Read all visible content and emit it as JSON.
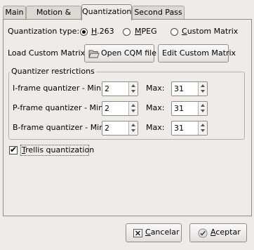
{
  "tabs": [
    {
      "label": "Main"
    },
    {
      "label": "Motion & Misc"
    },
    {
      "label": "Quantization"
    },
    {
      "label": "Second Pass"
    }
  ],
  "quant_type": {
    "label": "Quantization type:",
    "options": [
      {
        "label": "H.263",
        "selected": true
      },
      {
        "label": "MPEG",
        "selected": false
      },
      {
        "label": "Custom Matrix",
        "selected": false
      }
    ]
  },
  "custom_matrix": {
    "label": "Load Custom Matrix:",
    "open_label": "Open CQM file",
    "edit_label": "Edit Custom Matrix"
  },
  "restrictions": {
    "title": "Quantizer restrictions",
    "rows": [
      {
        "min_label": "I-frame quantizer - Min:",
        "min": "2",
        "max_label": "Max:",
        "max": "31"
      },
      {
        "min_label": "P-frame quantizer - Min:",
        "min": "2",
        "max_label": "Max:",
        "max": "31"
      },
      {
        "min_label": "B-frame quantizer - Min:",
        "min": "2",
        "max_label": "Max:",
        "max": "31"
      }
    ]
  },
  "trellis": {
    "label": "Trellis quantization",
    "checked": true
  },
  "footer": {
    "cancel_label": "Cancelar",
    "accept_label": "Aceptar"
  }
}
